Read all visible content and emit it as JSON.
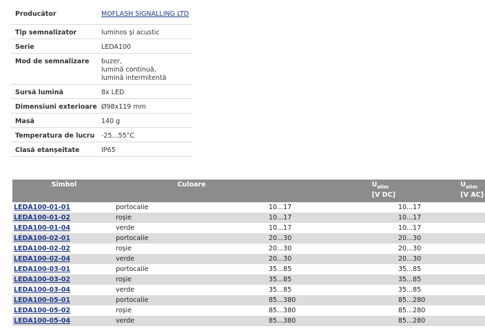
{
  "spec": [
    {
      "key": "Producător",
      "value": "MOFLASH SIGNALLING LTD",
      "link": true
    },
    {
      "key": "Tip semnalizator",
      "value": "luminos și acustic"
    },
    {
      "key": "Serie",
      "value": "LEDA100"
    },
    {
      "key": "Mod de semnalizare",
      "lines": [
        "buzer,",
        "lumină continuă,",
        "lumină intermitentă"
      ]
    },
    {
      "key": "Sursă lumină",
      "value": "8x LED"
    },
    {
      "key": "Dimensiuni exterioare",
      "value": "Ø98x119 mm"
    },
    {
      "key": "Masă",
      "value": "140 g"
    },
    {
      "key": "Temperatura de lucru",
      "value": "-25...55°C"
    },
    {
      "key": "Clasă etanșeitate",
      "value": "IP65"
    }
  ],
  "products": {
    "headers": {
      "simbol": "Simbol",
      "culoare": "Culoare",
      "u_main": "U",
      "u_sub": "alim",
      "vdc": "[V DC]",
      "vac": "[V AC]"
    },
    "rows": [
      {
        "simbol": "LEDA100-01-01",
        "culoare": "portocalie",
        "vdc": "10...17",
        "vac": "10...17"
      },
      {
        "simbol": "LEDA100-01-02",
        "culoare": "roșie",
        "vdc": "10...17",
        "vac": "10...17"
      },
      {
        "simbol": "LEDA100-01-04",
        "culoare": "verde",
        "vdc": "10...17",
        "vac": "10...17"
      },
      {
        "simbol": "LEDA100-02-01",
        "culoare": "portocalie",
        "vdc": "20...30",
        "vac": "20...30"
      },
      {
        "simbol": "LEDA100-02-02",
        "culoare": "roșie",
        "vdc": "20...30",
        "vac": "20...30"
      },
      {
        "simbol": "LEDA100-02-04",
        "culoare": "verde",
        "vdc": "20...30",
        "vac": "20...30"
      },
      {
        "simbol": "LEDA100-03-01",
        "culoare": "portocalie",
        "vdc": "35...85",
        "vac": "35...85"
      },
      {
        "simbol": "LEDA100-03-02",
        "culoare": "roșie",
        "vdc": "35...85",
        "vac": "35...85"
      },
      {
        "simbol": "LEDA100-03-04",
        "culoare": "verde",
        "vdc": "35...85",
        "vac": "35...85"
      },
      {
        "simbol": "LEDA100-05-01",
        "culoare": "portocalie",
        "vdc": "85...380",
        "vac": "85...280"
      },
      {
        "simbol": "LEDA100-05-02",
        "culoare": "roșie",
        "vdc": "85...380",
        "vac": "85...280"
      },
      {
        "simbol": "LEDA100-05-04",
        "culoare": "verde",
        "vdc": "85...380",
        "vac": "85...280"
      }
    ]
  }
}
